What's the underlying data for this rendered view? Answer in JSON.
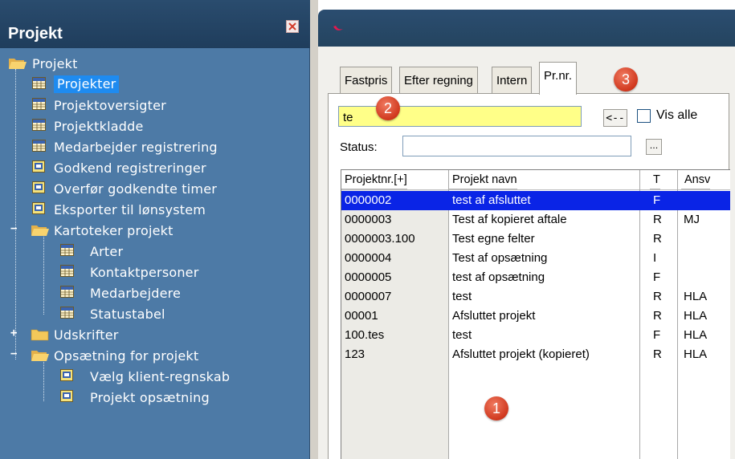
{
  "left_panel": {
    "title": "Projekt",
    "root": "Projekt",
    "items": [
      {
        "label": "Projekter"
      },
      {
        "label": "Projektoversigter"
      },
      {
        "label": "Projektkladde"
      },
      {
        "label": "Medarbejder registrering"
      },
      {
        "label": "Godkend registreringer"
      },
      {
        "label": "Overfør godkendte timer"
      },
      {
        "label": "Eksporter til lønsystem"
      },
      {
        "label": "Kartoteker projekt"
      },
      {
        "label": "Arter"
      },
      {
        "label": "Kontaktpersoner"
      },
      {
        "label": "Medarbejdere"
      },
      {
        "label": "Statustabel"
      },
      {
        "label": "Udskrifter"
      },
      {
        "label": "Opsætning for projekt"
      },
      {
        "label": "Vælg klient-regnskab"
      },
      {
        "label": "Projekt opsætning"
      }
    ]
  },
  "tabs": [
    {
      "label": "Fastpris"
    },
    {
      "label": "Efter regning"
    },
    {
      "label": "Intern"
    },
    {
      "label": "Pr.nr."
    }
  ],
  "search": {
    "value": "te",
    "back_label": "<--",
    "vis_alle_label": "Vis alle"
  },
  "status": {
    "label": "Status:",
    "value": "",
    "button_label": "..."
  },
  "table": {
    "headers": [
      "Projektnr.[+]",
      "Projekt navn",
      "T",
      "Ansv"
    ],
    "rows": [
      {
        "nr": "0000002",
        "navn": "test af afsluttet",
        "t": "F",
        "ansv": ""
      },
      {
        "nr": "0000003",
        "navn": "Test af kopieret aftale",
        "t": "R",
        "ansv": "MJ"
      },
      {
        "nr": "0000003.100",
        "navn": "Test egne felter",
        "t": "R",
        "ansv": ""
      },
      {
        "nr": "0000004",
        "navn": "Test af opsætning",
        "t": "I",
        "ansv": ""
      },
      {
        "nr": "0000005",
        "navn": "test af opsætning",
        "t": "F",
        "ansv": ""
      },
      {
        "nr": "0000007",
        "navn": "test",
        "t": "R",
        "ansv": "HLA"
      },
      {
        "nr": "00001",
        "navn": "Afsluttet projekt",
        "t": "R",
        "ansv": "HLA"
      },
      {
        "nr": "100.tes",
        "navn": "test",
        "t": "F",
        "ansv": "HLA"
      },
      {
        "nr": "123",
        "navn": "Afsluttet projekt (kopieret)",
        "t": "R",
        "ansv": "HLA"
      }
    ]
  },
  "callouts": [
    "1",
    "2",
    "3"
  ],
  "colors": {
    "selection": "#0a24e6",
    "tree_bg": "#4d7aa6",
    "search_bg": "#ffff88",
    "callout": "#d0381e"
  }
}
